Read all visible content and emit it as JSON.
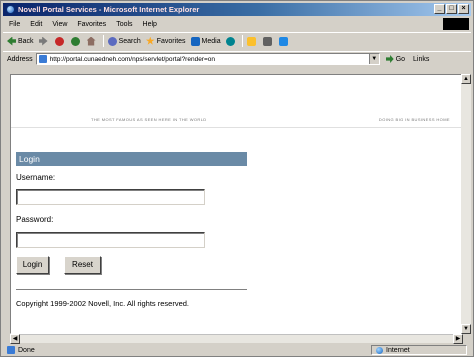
{
  "window": {
    "title": "Novell Portal Services - Microsoft Internet Explorer",
    "controls": {
      "minimize": "_",
      "maximize": "□",
      "close": "×"
    }
  },
  "menubar": {
    "items": [
      {
        "label": "File"
      },
      {
        "label": "Edit"
      },
      {
        "label": "View"
      },
      {
        "label": "Favorites"
      },
      {
        "label": "Tools"
      },
      {
        "label": "Help"
      }
    ]
  },
  "toolbar": {
    "back_label": "Back",
    "search_label": "Search",
    "favorites_label": "Favorites",
    "media_label": "Media"
  },
  "address": {
    "label": "Address",
    "url": "http://portal.cunaedneh.com/nps/servlet/portal?render=on",
    "go_label": "Go",
    "links_label": "Links"
  },
  "banner": {
    "tagline_left": "THE MOST FAMOUS AS SEEN HERE IN THE WORLD",
    "tagline_right": "DOING BIG IN BUSINESS HOME"
  },
  "login": {
    "header": "Login",
    "username_label": "Username:",
    "username_value": "",
    "password_label": "Password:",
    "password_value": "",
    "login_button": "Login",
    "reset_button": "Reset"
  },
  "footer": {
    "copyright": "Copyright 1999-2002 Novell, Inc. All rights reserved."
  },
  "status": {
    "text": "Done",
    "zone": "Internet"
  },
  "colors": {
    "title_bar": "#0a246a",
    "login_header": "#6a8aa6",
    "chrome": "#d4d0c8"
  }
}
